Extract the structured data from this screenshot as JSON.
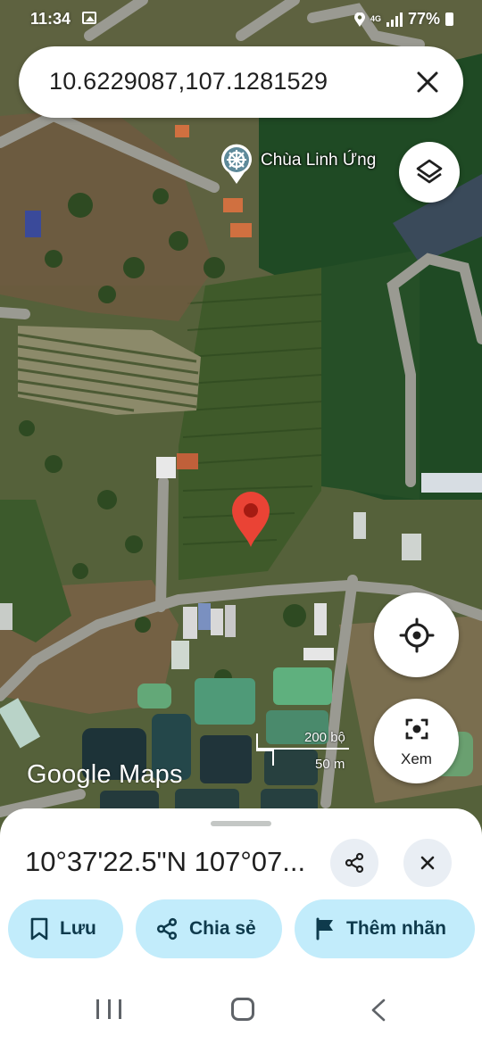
{
  "status_bar": {
    "time": "11:34",
    "network_label": "4G",
    "battery": "77%",
    "icons": [
      "gallery-icon",
      "location-icon",
      "signal-icon",
      "battery-icon"
    ]
  },
  "search": {
    "query": "10.6229087,107.1281529",
    "close_icon": "close-icon"
  },
  "map": {
    "poi_label": "Chùa Linh Ứng",
    "poi_icon": "dharma-wheel-icon",
    "layers_icon": "layers-icon",
    "my_location_icon": "my-location-icon",
    "view_button_label": "Xem",
    "view_icon": "camera-icon",
    "scale_imperial": "200 bộ",
    "scale_metric": "50 m",
    "brand": "Google Maps",
    "pin_color": "#ea4335"
  },
  "sheet": {
    "coordinates": "10°37'22.5\"N 107°07...",
    "share_icon": "share-icon",
    "close_icon": "close-icon",
    "chips": {
      "save": "Lưu",
      "share": "Chia sẻ",
      "label": "Thêm nhãn"
    },
    "chip_color": "#c2ecfb"
  },
  "nav": {
    "recents_icon": "recents-icon",
    "home_icon": "home-icon",
    "back_icon": "back-icon"
  }
}
